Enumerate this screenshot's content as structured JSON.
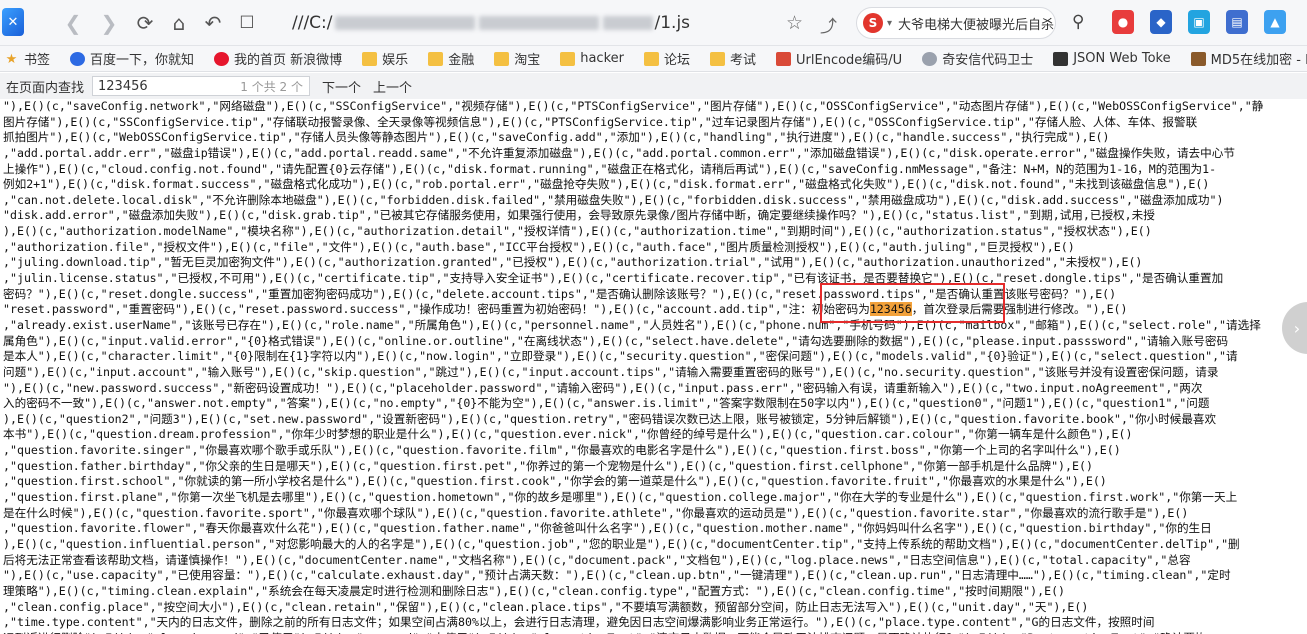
{
  "toolbar": {
    "url_text": "///C:/",
    "url_suffix": "/1.js",
    "search_engine_letter": "S",
    "search_text": "大爷电梯大便被曝光后自杀",
    "icons": [
      "back-icon",
      "forward-icon",
      "refresh-icon",
      "home-icon",
      "undo-icon",
      "bookmark-star-icon",
      "share-icon",
      "search-icon"
    ]
  },
  "bookmarks": [
    {
      "label": "书签",
      "icon": "star-icon"
    },
    {
      "label": "百度一下，你就知",
      "icon": "baidu-icon"
    },
    {
      "label": "我的首页 新浪微博",
      "icon": "weibo-icon"
    },
    {
      "label": "娱乐",
      "icon": "folder-icon"
    },
    {
      "label": "金融",
      "icon": "folder-icon"
    },
    {
      "label": "淘宝",
      "icon": "folder-icon"
    },
    {
      "label": "hacker",
      "icon": "folder-icon"
    },
    {
      "label": "论坛",
      "icon": "folder-icon"
    },
    {
      "label": "考试",
      "icon": "folder-icon"
    },
    {
      "label": "UrlEncode编码/U",
      "icon": "urlencode-icon"
    },
    {
      "label": "奇安信代码卫士",
      "icon": "qianxin-icon"
    },
    {
      "label": "JSON Web Toke",
      "icon": "jwt-icon"
    },
    {
      "label": "MD5在线加密 - Im",
      "icon": "md5-icon"
    }
  ],
  "findbar": {
    "label": "在页面内查找",
    "query": "123456",
    "count": "1 个共 2 个",
    "next": "下一个",
    "prev": "上一个"
  },
  "content": {
    "highlight": "123456",
    "lines": [
      "\"),E()(c,\"saveConfig.network\",\"网络磁盘\"),E()(c,\"SSConfigService\",\"视频存储\"),E()(c,\"PTSConfigService\",\"图片存储\"),E()(c,\"OSSConfigService\",\"动态图片存储\"),E()(c,\"WebOSSConfigService\",\"静",
      "图片存储\"),E()(c,\"SSConfigService.tip\",\"存储联动报警录像、全天录像等视频信息\"),E()(c,\"PTSConfigService.tip\",\"过车记录图片存储\"),E()(c,\"OSSConfigService.tip\",\"存储人脸、人体、车体、报警联",
      "抓拍图片\"),E()(c,\"WebOSSConfigService.tip\",\"存储人员头像等静态图片\"),E()(c,\"saveConfig.add\",\"添加\"),E()(c,\"handling\",\"执行进度\"),E()(c,\"handle.success\",\"执行完成\"),E()",
      ",\"add.portal.addr.err\",\"磁盘ip错误\"),E()(c,\"add.portal.readd.same\",\"不允许重复添加磁盘\"),E()(c,\"add.portal.common.err\",\"添加磁盘错误\"),E()(c,\"disk.operate.error\",\"磁盘操作失败，请去中心节",
      "上操作\"),E()(c,\"cloud.config.not.found\",\"请先配置{0}云存储\"),E()(c,\"disk.format.running\",\"磁盘正在格式化，请稍后再试\"),E()(c,\"saveConfig.nmMessage\",\"备注：N+M，N的范围为1-16，M的范围为1-",
      "例如2+1\"),E()(c,\"disk.format.success\",\"磁盘格式化成功\"),E()(c,\"rob.portal.err\",\"磁盘抢夺失败\"),E()(c,\"disk.format.err\",\"磁盘格式化失败\"),E()(c,\"disk.not.found\",\"未找到该磁盘信息\"),E()",
      ",\"can.not.delete.local.disk\",\"不允许删除本地磁盘\"),E()(c,\"forbidden.disk.failed\",\"禁用磁盘失败\"),E()(c,\"forbidden.disk.success\",\"禁用磁盘成功\"),E()(c,\"disk.add.success\",\"磁盘添加成功\")",
      "\"disk.add.error\",\"磁盘添加失败\"),E()(c,\"disk.grab.tip\",\"已被其它存储服务使用，如果强行使用，会导致原先录像/图片存储中断，确定要继续操作吗？\"),E()(c,\"status.list\",\"到期,试用,已授权,未授",
      "),E()(c,\"authorization.modelName\",\"模块名称\"),E()(c,\"authorization.detail\",\"授权详情\"),E()(c,\"authorization.time\",\"到期时间\"),E()(c,\"authorization.status\",\"授权状态\"),E()",
      ",\"authorization.file\",\"授权文件\"),E()(c,\"file\",\"文件\"),E()(c,\"auth.base\",\"ICC平台授权\"),E()(c,\"auth.face\",\"图片质量检测授权\"),E()(c,\"auth.juling\",\"巨灵授权\"),E()",
      ",\"juling.download.tip\",\"暂无巨灵加密狗文件\"),E()(c,\"authorization.granted\",\"已授权\"),E()(c,\"authorization.trial\",\"试用\"),E()(c,\"authorization.unauthorized\",\"未授权\"),E()",
      ",\"julin.license.status\",\"已授权,不可用\"),E()(c,\"certificate.tip\",\"支持导入安全证书\"),E()(c,\"certificate.recover.tip\",\"已有该证书，是否要替换它\"),E()(c,\"reset.dongle.tips\",\"是否确认重置加",
      "密码？\"),E()(c,\"reset.dongle.success\",\"重置加密狗密码成功\"),E()(c,\"delete.account.tips\",\"是否确认删除该账号？\"),E()(c,\"reset.password.tips\",\"是否确认重置该账号密码？\"),E()",
      "\"reset.password\",\"重置密码\"),E()(c,\"reset.password.success\",\"操作成功！密码重置为初始密码！\"),E()(c,\"account.add.tip\",\"注：初始密码为123456，首次登录后需要强制进行修改。\"),E()",
      ",\"already.exist.userName\",\"该账号已存在\"),E()(c,\"role.name\",\"所属角色\"),E()(c,\"personnel.name\",\"人员姓名\"),E()(c,\"phone.num\",\"手机号码\"),E()(c,\"mailbox\",\"邮箱\"),E()(c,\"select.role\",\"请选择",
      "属角色\"),E()(c,\"input.valid.error\",\"{0}格式错误\"),E()(c,\"online.or.outline\",\"在离线状态\"),E()(c,\"select.have.delete\",\"请勾选要删除的数据\"),E()(c,\"please.input.passsword\",\"请输入账号密码",
      "是本人\"),E()(c,\"character.limit\",\"{0}限制在{1}字符以内\"),E()(c,\"now.login\",\"立即登录\"),E()(c,\"security.question\",\"密保问题\"),E()(c,\"models.valid\",\"{0}验证\"),E()(c,\"select.question\",\"请",
      "问题\"),E()(c,\"input.account\",\"输入账号\"),E()(c,\"skip.question\",\"跳过\"),E()(c,\"input.account.tips\",\"请输入需要重置密码的账号\"),E()(c,\"no.security.question\",\"该账号并没有设置密保问题，请录",
      "\"),E()(c,\"new.password.success\",\"新密码设置成功！\"),E()(c,\"placeholder.password\",\"请输入密码\"),E()(c,\"input.pass.err\",\"密码输入有误，请重新输入\"),E()(c,\"two.input.noAgreement\",\"两次",
      "入的密码不一致\"),E()(c,\"answer.not.empty\",\"答案\"),E()(c,\"no.empty\",\"{0}不能为空\"),E()(c,\"answer.is.limit\",\"答案字数限制在50字以内\"),E()(c,\"question0\",\"问题1\"),E()(c,\"question1\",\"问题",
      "),E()(c,\"question2\",\"问题3\"),E()(c,\"set.new.password\",\"设置新密码\"),E()(c,\"question.retry\",\"密码错误次数已达上限，账号被锁定，5分钟后解锁\"),E()(c,\"question.favorite.book\",\"你小时候最喜欢",
      "本书\"),E()(c,\"question.dream.profession\",\"你年少时梦想的职业是什么\"),E()(c,\"question.ever.nick\",\"你曾经的绰号是什么\"),E()(c,\"question.car.colour\",\"你第一辆车是什么颜色\"),E()",
      ",\"question.favorite.singer\",\"你最喜欢哪个歌手或乐队\"),E()(c,\"question.favorite.film\",\"你最喜欢的电影名字是什么\"),E()(c,\"question.first.boss\",\"你第一个上司的名字叫什么\"),E()",
      ",\"question.father.birthday\",\"你父亲的生日是哪天\"),E()(c,\"question.first.pet\",\"你养过的第一个宠物是什么\"),E()(c,\"question.first.cellphone\",\"你第一部手机是什么品牌\"),E()",
      ",\"question.first.school\",\"你就读的第一所小学校名是什么\"),E()(c,\"question.first.cook\",\"你学会的第一道菜是什么\"),E()(c,\"question.favorite.fruit\",\"你最喜欢的水果是什么\"),E()",
      ",\"question.first.plane\",\"你第一次坐飞机是去哪里\"),E()(c,\"question.hometown\",\"你的故乡是哪里\"),E()(c,\"question.college.major\",\"你在大学的专业是什么\"),E()(c,\"question.first.work\",\"你第一天上",
      "是在什么时候\"),E()(c,\"question.favorite.sport\",\"你最喜欢哪个球队\"),E()(c,\"question.favorite.athlete\",\"你最喜欢的运动员是\"),E()(c,\"question.favorite.star\",\"你最喜欢的流行歌手是\"),E()",
      ",\"question.favorite.flower\",\"春天你最喜欢什么花\"),E()(c,\"question.father.name\",\"你爸爸叫什么名字\"),E()(c,\"question.mother.name\",\"你妈妈叫什么名字\"),E()(c,\"question.birthday\",\"你的生日",
      "),E()(c,\"question.influential.person\",\"对您影响最大的人的名字是\"),E()(c,\"question.job\",\"您的职业是\"),E()(c,\"documentCenter.tip\",\"支持上传系统的帮助文档\"),E()(c,\"documentCenter.delTip\",\"删",
      "后将无法正常查看该帮助文档，请谨慎操作！\"),E()(c,\"documentCenter.name\",\"文档名称\"),E()(c,\"document.pack\",\"文档包\"),E()(c,\"log.place.news\",\"日志空间信息\"),E()(c,\"total.capacity\",\"总容",
      "\"),E()(c,\"use.capacity\",\"已使用容量：\"),E()(c,\"calculate.exhaust.day\",\"预计占满天数：\"),E()(c,\"clean.up.btn\",\"一键清理\"),E()(c,\"clean.up.run\",\"日志清理中……\"),E()(c,\"timing.clean\",\"定时",
      "理策略\"),E()(c,\"timing.clean.explain\",\"系统会在每天凌晨定时进行检测和删除日志\"),E()(c,\"clean.config.type\",\"配置方式：\"),E()(c,\"clean.config.time\",\"按时间期限\"),E()",
      ",\"clean.config.place\",\"按空间大小\"),E()(c,\"clean.retain\",\"保留\"),E()(c,\"clean.place.tips\",\"不要填写满额数，预留部分空间，防止日志无法写入\"),E()(c,\"unit.day\",\"天\"),E()",
      ",\"time.type.content\",\"天内的日志文件，删除之前的所有日志文件；如果空间占满80%以上，会进行日志清理，避免因日志空间爆满影响业务正常运行。\"),E()(c,\"place.type.content\",\"G的日志文件，按照时间",
      "远到近进行删除\"),E()(c,\"already.used\",\"已使用\"),E()(c,\"no.used\",\"未使用\"),E()(c,\"clean.tipsText\",\"清空日志数据，可能会导致无法排查问题，是否确认执行？\"),E()(c,\"Restore.tipsText\",\"确认要恢",
      "系统默认的配置参数吗？\"),E()(c,\"file.name\",\"文件名\"),E()(c,\"bind.service\",\"所属服务\"),E()(c,\"modify.time\",\"修改时间\"),E()(c,\"service.log\",\"服务日志\"),E()(c,\"log\",\"日志\"),E()"
    ]
  },
  "colors": {
    "highlight": "#f2a13a",
    "annotation_box": "#e42b2b"
  }
}
